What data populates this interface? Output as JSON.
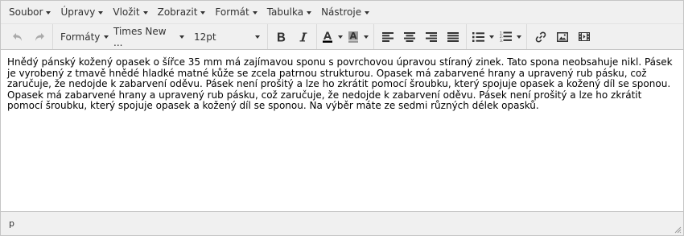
{
  "menubar": {
    "items": [
      "Soubor",
      "Úpravy",
      "Vložit",
      "Zobrazit",
      "Formát",
      "Tabulka",
      "Nástroje"
    ]
  },
  "toolbar": {
    "formats_label": "Formáty",
    "font_family": "Times New ...",
    "font_size": "12pt",
    "icons": [
      "undo-icon",
      "redo-icon",
      "bold-icon",
      "italic-icon",
      "text-color-icon",
      "background-color-icon",
      "align-left-icon",
      "align-center-icon",
      "align-right-icon",
      "align-justify-icon",
      "bullet-list-icon",
      "numbered-list-icon",
      "link-icon",
      "image-icon",
      "media-icon",
      "resize-handle-icon"
    ],
    "colors": {
      "text_color_bar": "#000000",
      "bg_color_bar": "#999999"
    }
  },
  "content": {
    "text": "Hnědý pánský kožený opasek o šířce 35 mm má zajímavou sponu s povrchovou úpravou stíraný zinek. Tato spona neobsahuje nikl. Pásek je vyrobený z tmavě hnědé hladké matné kůže se zcela patrnou strukturou. Opasek má zabarvené hrany a upravený rub pásku, což zaručuje, že nedojde k zabarvení oděvu. Pásek není prošitý a lze ho zkrátit pomocí šroubku, který spojuje opasek a kožený díl se sponou. Opasek má zabarvené hrany a upravený rub pásku, což zaručuje, že nedojde k zabarvení oděvu. Pásek není prošitý a lze ho zkrátit pomocí šroubku, který spojuje opasek a kožený díl se sponou. Na výběr máte ze sedmi různých délek opasků."
  },
  "statusbar": {
    "path": "p"
  }
}
